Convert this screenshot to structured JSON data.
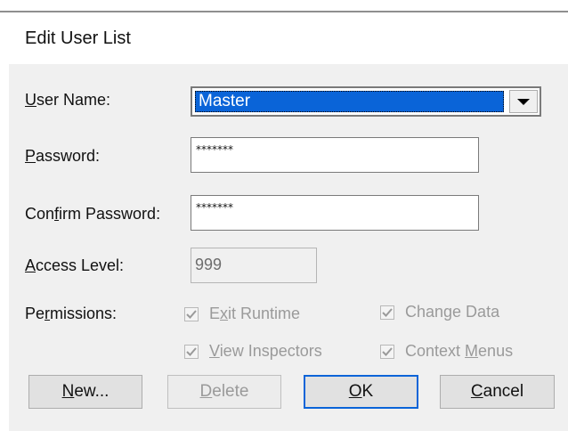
{
  "dialog": {
    "title": "Edit User List"
  },
  "user_name": {
    "label_pre": "",
    "label_ul": "U",
    "label_post": "ser Name:",
    "value": "Master"
  },
  "password": {
    "label_pre": "",
    "label_ul": "P",
    "label_post": "assword:",
    "value": "*******"
  },
  "confirm_password": {
    "label_pre": "Con",
    "label_ul": "f",
    "label_post": "irm Password:",
    "value": "*******"
  },
  "access_level": {
    "label_pre": "",
    "label_ul": "A",
    "label_post": "ccess Level:",
    "value": "999"
  },
  "permissions": {
    "label_pre": "Pe",
    "label_ul": "r",
    "label_post": "missions:",
    "items": [
      {
        "pre": "E",
        "ul": "x",
        "post": "it Runtime",
        "checked": true
      },
      {
        "pre": "",
        "ul": "",
        "post": "Change Data",
        "checked": true
      },
      {
        "pre": "",
        "ul": "V",
        "post": "iew Inspectors",
        "checked": true
      },
      {
        "pre": "Context ",
        "ul": "M",
        "post": "enus",
        "checked": true
      }
    ]
  },
  "buttons": {
    "new": {
      "ul": "N",
      "post": "ew..."
    },
    "delete": {
      "ul": "D",
      "post": "elete"
    },
    "ok": {
      "ul": "O",
      "post": "K"
    },
    "cancel": {
      "ul": "C",
      "post": "ancel"
    }
  },
  "colors": {
    "selection": "#0a64d8",
    "panel": "#f0f0f0",
    "disabled_text": "#9a9a9a"
  }
}
